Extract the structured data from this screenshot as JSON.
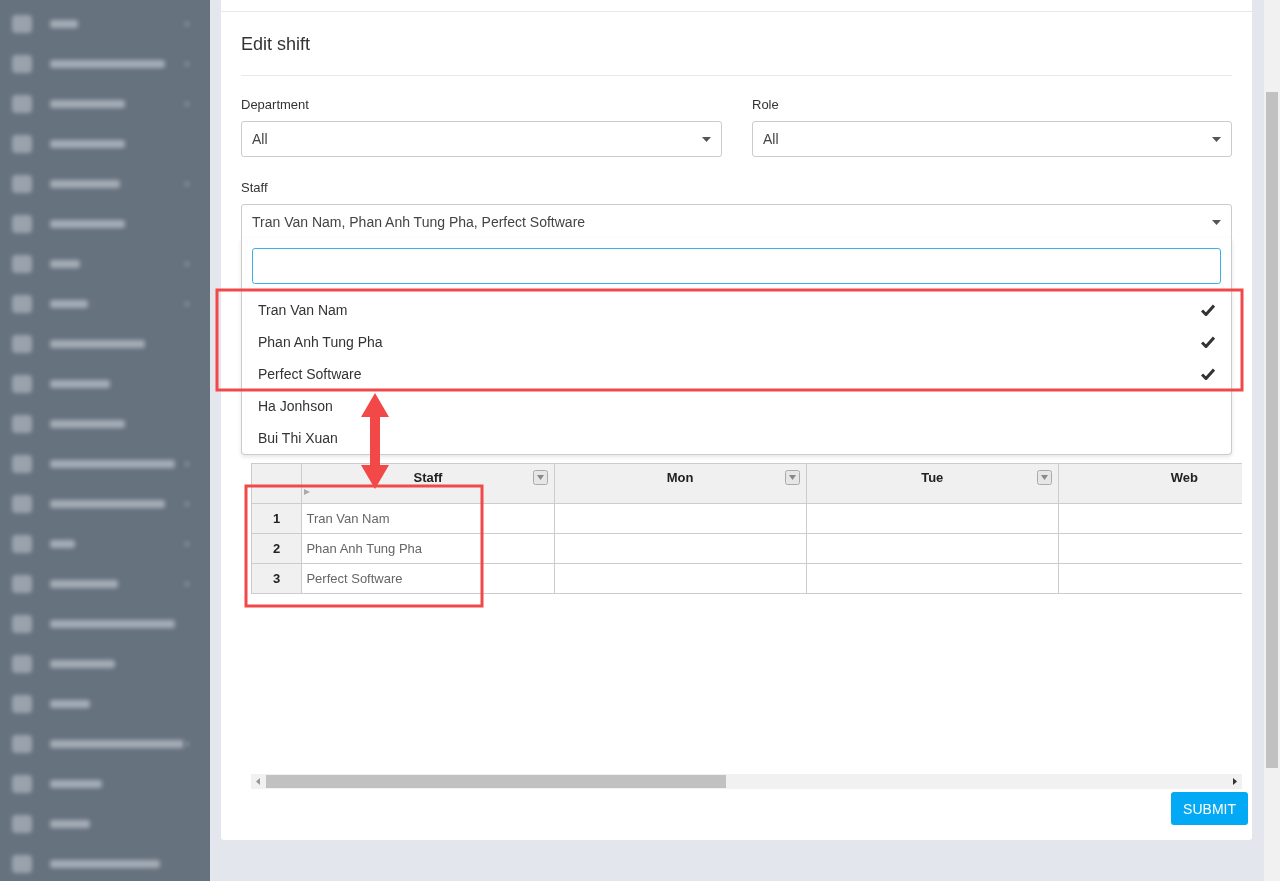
{
  "sidebar": {
    "items": [
      {
        "expandable": true
      },
      {
        "expandable": true
      },
      {
        "expandable": true
      },
      {
        "expandable": false
      },
      {
        "expandable": true
      },
      {
        "expandable": false
      },
      {
        "expandable": true
      },
      {
        "expandable": true
      },
      {
        "expandable": false
      },
      {
        "expandable": false
      },
      {
        "expandable": false
      },
      {
        "expandable": true
      },
      {
        "expandable": true
      },
      {
        "expandable": true
      },
      {
        "expandable": true
      },
      {
        "expandable": false
      },
      {
        "expandable": false
      },
      {
        "expandable": false
      },
      {
        "expandable": true
      },
      {
        "expandable": false
      },
      {
        "expandable": false
      },
      {
        "expandable": false
      }
    ]
  },
  "form": {
    "title": "Edit shift",
    "filters": [
      {
        "label": "Department",
        "value": "All"
      },
      {
        "label": "Role",
        "value": "All"
      }
    ],
    "staff": {
      "label": "Staff",
      "value": "Tran Van Nam, Phan Anh Tung Pha, Perfect Software",
      "expanded": true,
      "options": [
        {
          "label": "Tran Van Nam",
          "selected": true
        },
        {
          "label": "Phan Anh Tung Pha",
          "selected": true
        },
        {
          "label": "Perfect Software",
          "selected": true
        },
        {
          "label": "Ha Jonhson",
          "selected": false
        },
        {
          "label": "Bui Thi Xuan",
          "selected": false
        }
      ]
    }
  },
  "table": {
    "columns": [
      {
        "label": "Staff",
        "filter": true
      },
      {
        "label": "Mon",
        "filter": true
      },
      {
        "label": "Tue",
        "filter": true
      },
      {
        "label": "Web",
        "filter": false
      }
    ],
    "rows": [
      {
        "number": "1",
        "staff": "Tran Van Nam"
      },
      {
        "number": "2",
        "staff": "Phan Anh Tung Pha"
      },
      {
        "number": "3",
        "staff": "Perfect Software"
      }
    ]
  },
  "submit": "SUBMIT"
}
